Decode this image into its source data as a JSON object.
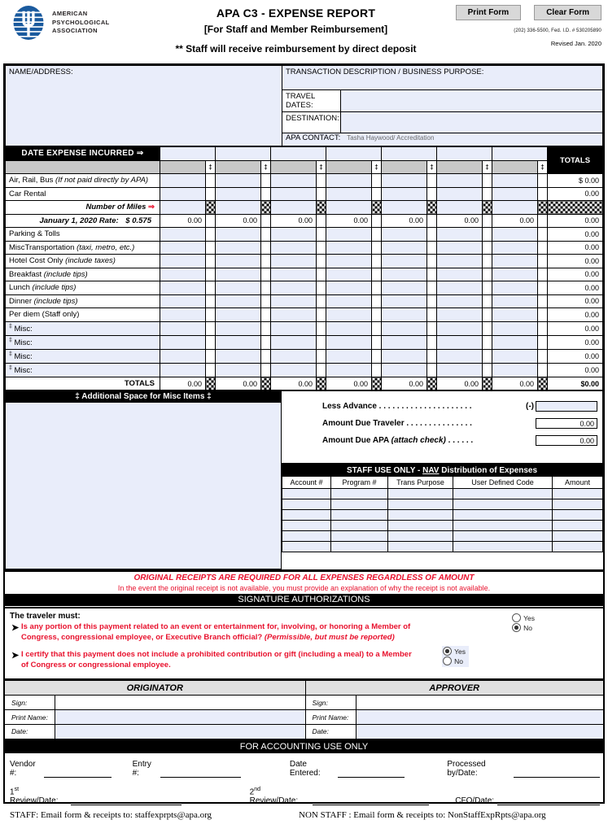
{
  "header": {
    "org_line1": "AMERICAN",
    "org_line2": "PSYCHOLOGICAL",
    "org_line3": "ASSOCIATION",
    "title": "APA C3 - EXPENSE REPORT",
    "subtitle": "[For Staff and Member Reimbursement]",
    "notice": "** Staff will receive reimbursement by direct deposit",
    "print_button": "Print Form",
    "clear_button": "Clear Form",
    "fineprint": "(202) 336-5500, Fed. I.D. # 530205890",
    "revised": "Revised Jan. 2020"
  },
  "top_info": {
    "name_address_label": "NAME/ADDRESS:",
    "name_address_value": "",
    "transaction_label": "TRANSACTION DESCRIPTION / BUSINESS PURPOSE:",
    "transaction_value": "",
    "travel_dates_label": "TRAVEL DATES:",
    "travel_dates_value": "",
    "destination_label": "DESTINATION:",
    "destination_value": "",
    "apa_contact_label": "APA CONTACT:",
    "apa_contact_value": "Tasha Haywood/ Accreditation"
  },
  "expense_table": {
    "date_header": "DATE EXPENSE INCURRED",
    "date_arrow": "⇒",
    "totals_header": "TOTALS",
    "misc_marker": "‡",
    "miles_arrow": "⇒",
    "dates": [
      "",
      "",
      "",
      "",
      "",
      "",
      ""
    ],
    "rows": [
      {
        "label": "Air, Rail, Bus",
        "note": "(If not paid directly by APA)",
        "kind": "input",
        "values": [
          "",
          "",
          "",
          "",
          "",
          "",
          ""
        ],
        "total": "$ 0.00"
      },
      {
        "label": "Car Rental",
        "note": "",
        "kind": "input",
        "values": [
          "",
          "",
          "",
          "",
          "",
          "",
          ""
        ],
        "total": "0.00"
      },
      {
        "label": "Number of Miles",
        "note": "",
        "kind": "miles",
        "values": [
          "",
          "",
          "",
          "",
          "",
          "",
          ""
        ],
        "total": ""
      },
      {
        "label": "January 1, 2020 Rate:",
        "note": "$ 0.575",
        "kind": "calc",
        "values": [
          "0.00",
          "0.00",
          "0.00",
          "0.00",
          "0.00",
          "0.00",
          "0.00"
        ],
        "total": "0.00"
      },
      {
        "label": "Parking & Tolls",
        "note": "",
        "kind": "input",
        "values": [
          "",
          "",
          "",
          "",
          "",
          "",
          ""
        ],
        "total": "0.00"
      },
      {
        "label": "MiscTransportation",
        "note": "(taxi, metro, etc.)",
        "kind": "input",
        "values": [
          "",
          "",
          "",
          "",
          "",
          "",
          ""
        ],
        "total": "0.00"
      },
      {
        "label": "Hotel Cost Only",
        "note": "(include taxes)",
        "kind": "input",
        "values": [
          "",
          "",
          "",
          "",
          "",
          "",
          ""
        ],
        "total": "0.00"
      },
      {
        "label": "Breakfast",
        "note": "(include tips)",
        "kind": "input",
        "values": [
          "",
          "",
          "",
          "",
          "",
          "",
          ""
        ],
        "total": "0.00"
      },
      {
        "label": "Lunch",
        "note": "(include tips)",
        "kind": "input",
        "values": [
          "",
          "",
          "",
          "",
          "",
          "",
          ""
        ],
        "total": "0.00"
      },
      {
        "label": "Dinner",
        "note": "(include tips)",
        "kind": "input",
        "values": [
          "",
          "",
          "",
          "",
          "",
          "",
          ""
        ],
        "total": "0.00"
      },
      {
        "label": "Per diem (Staff only)",
        "note": "",
        "kind": "input",
        "values": [
          "",
          "",
          "",
          "",
          "",
          "",
          ""
        ],
        "total": "0.00"
      },
      {
        "label": "Misc:",
        "note": "",
        "kind": "misc",
        "values": [
          "",
          "",
          "",
          "",
          "",
          "",
          ""
        ],
        "total": "0.00"
      },
      {
        "label": "Misc:",
        "note": "",
        "kind": "misc",
        "values": [
          "",
          "",
          "",
          "",
          "",
          "",
          ""
        ],
        "total": "0.00"
      },
      {
        "label": "Misc:",
        "note": "",
        "kind": "misc",
        "values": [
          "",
          "",
          "",
          "",
          "",
          "",
          ""
        ],
        "total": "0.00"
      },
      {
        "label": "Misc:",
        "note": "",
        "kind": "misc",
        "values": [
          "",
          "",
          "",
          "",
          "",
          "",
          ""
        ],
        "total": "0.00"
      }
    ],
    "totals_row_label": "TOTALS",
    "totals_row_values": [
      "0.00",
      "0.00",
      "0.00",
      "0.00",
      "0.00",
      "0.00",
      "0.00"
    ],
    "grand_total": "$0.00"
  },
  "misc_space": {
    "header": "‡  Additional Space for Misc Items  ‡",
    "value": ""
  },
  "amounts": {
    "less_advance_label": "Less Advance . . . . . . . . . . . . . . . . . . . . .",
    "less_advance_paren": "(-)",
    "less_advance_value": "",
    "due_traveler_label": "Amount Due Traveler . . . . . . . . . . . . . . .",
    "due_traveler_value": "0.00",
    "due_apa_label_a": "Amount Due APA ",
    "due_apa_label_b": "(attach check)",
    "due_apa_label_c": " . . . . . .",
    "due_apa_value": "0.00"
  },
  "staff_use": {
    "header_a": "STAFF USE ONLY - ",
    "header_nav": "NAV",
    "header_b": " Distribution of Expenses",
    "columns": [
      "Account #",
      "Program #",
      "Trans Purpose",
      "User Defined Code",
      "Amount"
    ],
    "rows": [
      [
        "",
        "",
        "",
        "",
        ""
      ],
      [
        "",
        "",
        "",
        "",
        ""
      ],
      [
        "",
        "",
        "",
        "",
        ""
      ],
      [
        "",
        "",
        "",
        "",
        ""
      ],
      [
        "",
        "",
        "",
        "",
        ""
      ],
      [
        "",
        "",
        "",
        "",
        ""
      ]
    ]
  },
  "receipts_notice": {
    "line1": "ORIGINAL RECEIPTS ARE REQUIRED FOR ALL EXPENSES REGARDLESS OF AMOUNT",
    "line2": "In the event the original receipt is not available, you must provide an explanation of why the receipt is not available."
  },
  "signature": {
    "header": "SIGNATURE AUTHORIZATIONS",
    "traveler_must": "The traveler must:",
    "bullet": "➤",
    "q1_text": "Is any portion of this payment related to an event or entertainment for, involving, or honoring a Member of Congress, congressional employee, or Executive Branch official?  ",
    "q1_paren": "(Permissible, but must be reported)",
    "q1_yes": "Yes",
    "q1_no": "No",
    "q1_selected": "No",
    "q2_text": "I certify that this payment does not include a prohibited contribution or gift (including a meal) to a Member of Congress or congressional employee.",
    "q2_yes": "Yes",
    "q2_no": "No",
    "q2_selected": "Yes"
  },
  "signatures": {
    "originator": "ORIGINATOR",
    "approver": "APPROVER",
    "sign_label": "Sign:",
    "print_label": "Print Name:",
    "date_label": "Date:",
    "orig_sign": "",
    "orig_print": "",
    "orig_date": "",
    "appr_sign": "",
    "appr_print": "",
    "appr_date": ""
  },
  "accounting": {
    "header": "FOR ACCOUNTING USE ONLY",
    "vendor_label": "Vendor #:",
    "entry_label": "Entry #:",
    "date_entered_label": "Date Entered:",
    "processed_label": "Processed by/Date:",
    "review1_label_sup": "st",
    "review1_label": "Review/Date:",
    "review1_num": "1",
    "review2_num": "2",
    "review2_label_sup": "nd",
    "review2_label": "Review/Date:",
    "cfo_label": "CFO/Date:"
  },
  "footer": {
    "staff": "STAFF: Email form & receipts to: staffexprpts@apa.org",
    "non_staff": "NON STAFF : Email form & receipts to: NonStaffExpRpts@apa.org"
  },
  "colors": {
    "input_bg": "#e9edfa",
    "header_black": "#000000",
    "red": "#e8112d",
    "gray_bar": "#c8c8c8",
    "logo_blue": "#1a5a9e"
  }
}
